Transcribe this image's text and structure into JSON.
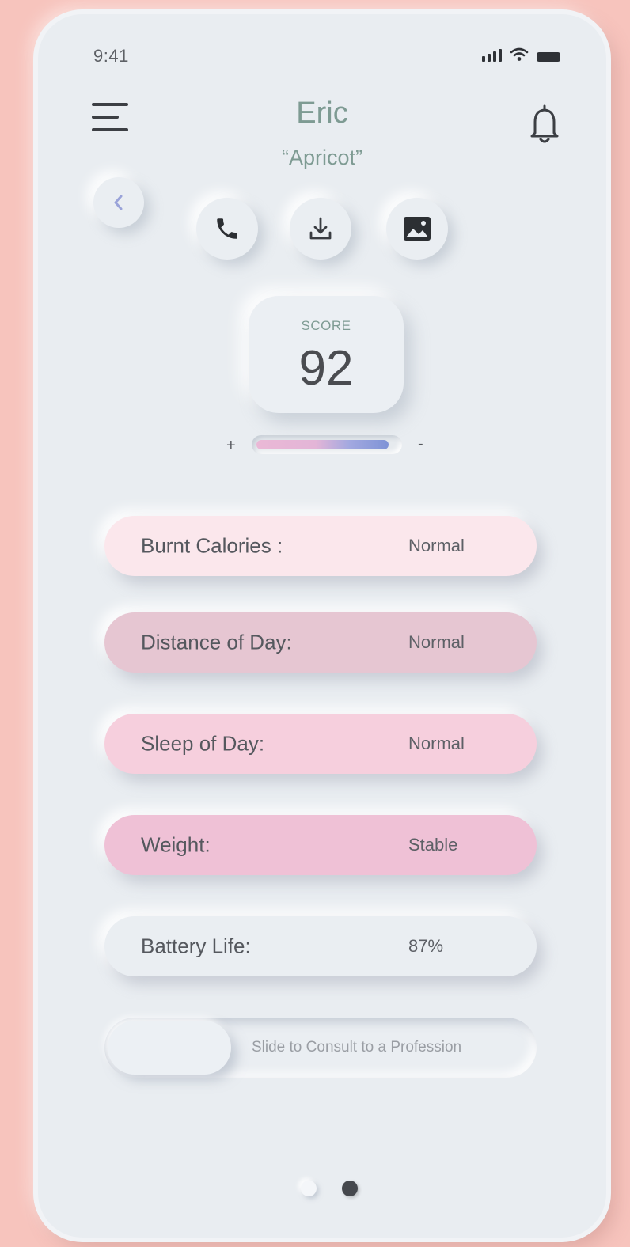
{
  "status_bar": {
    "time": "9:41",
    "icons": [
      "signal-icon",
      "wifi-icon",
      "battery-icon"
    ]
  },
  "header": {
    "name": "Eric",
    "nickname": "“Apricot”",
    "left_icon": "menu-icon",
    "right_icon": "bell-icon"
  },
  "actions": {
    "back_icon": "chevron-left-icon",
    "buttons": [
      "phone-icon",
      "download-icon",
      "image-icon"
    ]
  },
  "score": {
    "label": "SCORE",
    "value": "92",
    "level_plus": "+",
    "level_minus": "-",
    "level_fraction": 0.94
  },
  "stats": [
    {
      "label": "Burnt Calories :",
      "value": "Normal",
      "color": "#fbe7ec"
    },
    {
      "label": "Distance of Day:",
      "value": "Normal",
      "color": "#e6c6d2"
    },
    {
      "label": "Sleep of Day:",
      "value": "Normal",
      "color": "#f6cfdd"
    },
    {
      "label": "Weight:",
      "value": "Stable",
      "color": "#efc1d6"
    },
    {
      "label": "Battery Life:",
      "value": "87%",
      "color": "#eaeef2"
    }
  ],
  "slider": {
    "label": "Slide to Consult to a Profession"
  },
  "pagination": {
    "pages": 2,
    "active_page": 2
  },
  "colors": {
    "background": "#f7c4bd",
    "card": "#e9edf1",
    "accent_text": "#7e9b93",
    "dot_active": "#45484d"
  }
}
